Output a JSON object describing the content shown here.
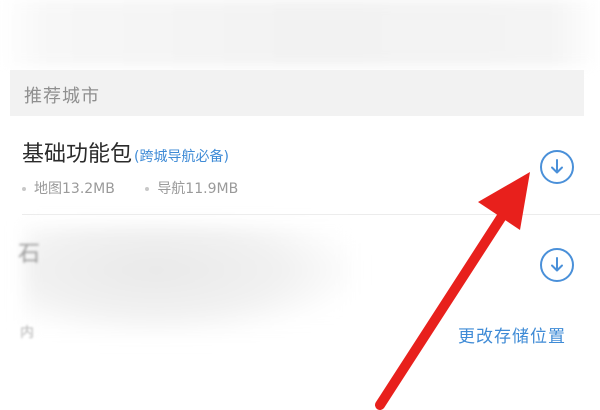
{
  "section": {
    "header_label": "推荐城市"
  },
  "package": {
    "title": "基础功能包",
    "tag": "(跨城导航必备)",
    "map_size": "地图13.2MB",
    "nav_size": "导航11.9MB"
  },
  "blurred_row": {
    "first_char": "石",
    "partial_text": "内"
  },
  "actions": {
    "change_storage": "更改存储位置"
  },
  "colors": {
    "accent": "#3f8bd6",
    "arrow": "#e8201c",
    "header_bg": "#f2f2f2"
  },
  "icons": {
    "download": "download-circle-icon"
  }
}
